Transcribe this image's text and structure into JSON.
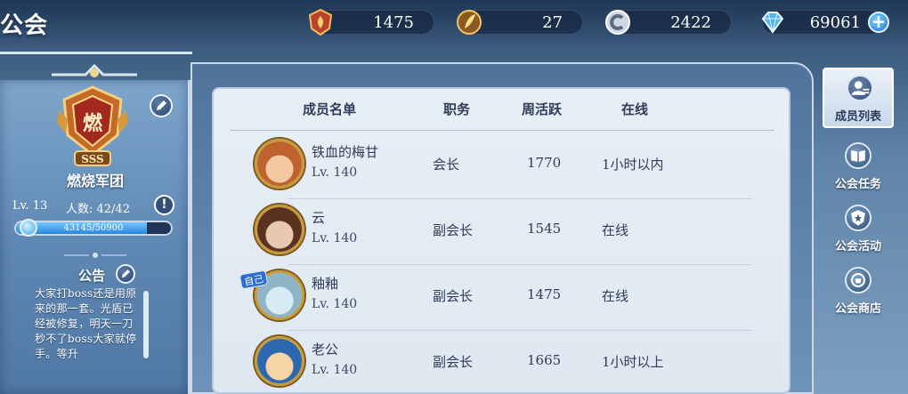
{
  "header": {
    "title": "公会",
    "resources": [
      {
        "name": "guild-badge",
        "value": "1475"
      },
      {
        "name": "feather-token",
        "value": "27"
      },
      {
        "name": "silver-coin",
        "value": "2422"
      },
      {
        "name": "diamond",
        "value": "69061"
      }
    ]
  },
  "guild": {
    "name": "燃烧军团",
    "emblem_text": "燃",
    "rank": "SSS",
    "level": "Lv. 13",
    "members": "人数: 42/42",
    "exp_text": "43145/50900",
    "exp_fraction": 0.8477,
    "notice_title": "公告",
    "notice_text": "大家打boss还是用原来的那一套。光盾已经被修复，明天一刀秒不了boss大家就停手。等升"
  },
  "list": {
    "headers": {
      "name": "成员名单",
      "role": "职务",
      "activity": "周活跃",
      "online": "在线"
    },
    "members": [
      {
        "name": "铁血的梅甘",
        "level": "Lv. 140",
        "role": "会长",
        "activity": "1770",
        "online": "1小时以内",
        "self": false,
        "avatar_colors": [
          "#f4c8a0",
          "#c0622e"
        ]
      },
      {
        "name": "云",
        "level": "Lv. 140",
        "role": "副会长",
        "activity": "1545",
        "online": "在线",
        "self": false,
        "avatar_colors": [
          "#e8c8b0",
          "#5a3320"
        ]
      },
      {
        "name": "釉釉",
        "level": "Lv. 140",
        "role": "副会长",
        "activity": "1475",
        "online": "在线",
        "self": true,
        "self_label": "自己",
        "avatar_colors": [
          "#d8ecf4",
          "#8fb4c8"
        ]
      },
      {
        "name": "老公",
        "level": "Lv. 140",
        "role": "副会长",
        "activity": "1665",
        "online": "1小时以上",
        "self": false,
        "avatar_colors": [
          "#f6d4a4",
          "#2c68b0"
        ]
      }
    ]
  },
  "tabs": [
    {
      "label": "成员列表",
      "active": true
    },
    {
      "label": "公会任务",
      "active": false
    },
    {
      "label": "公会活动",
      "active": false
    },
    {
      "label": "公会商店",
      "active": false
    }
  ],
  "colors": {
    "accent": "#2d6fd0",
    "gold": "#c79a3c",
    "panel": "#e8eef5"
  }
}
